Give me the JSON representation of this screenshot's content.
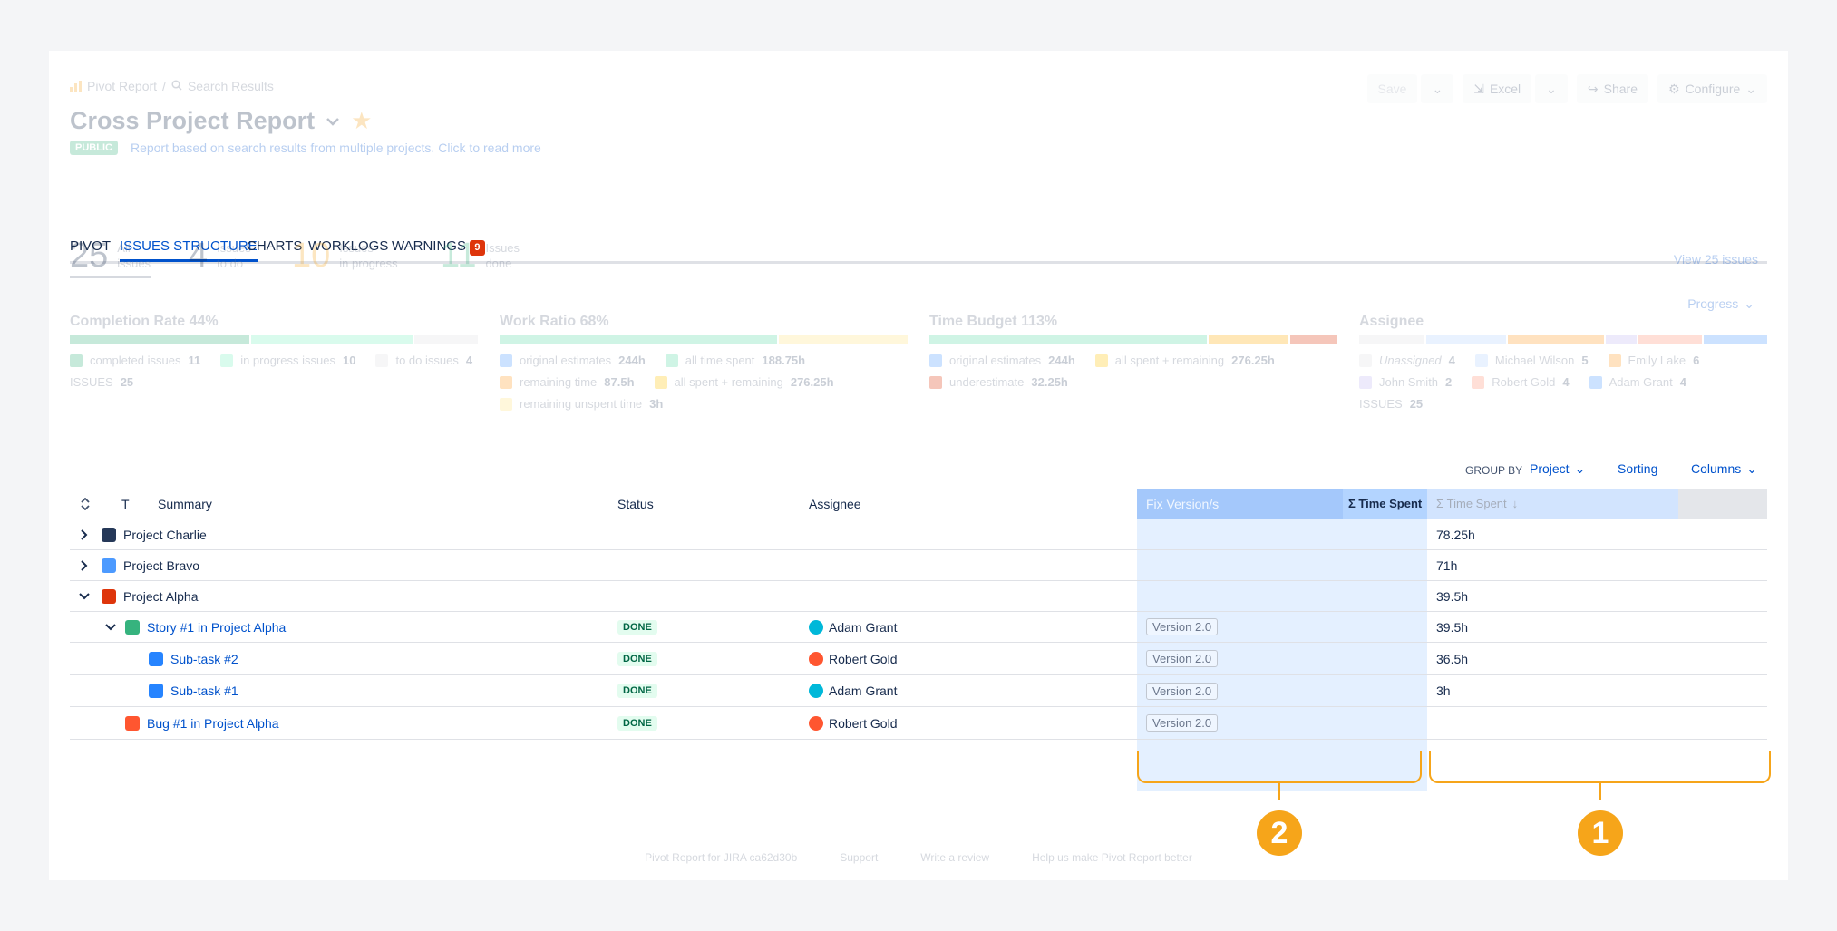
{
  "breadcrumb": {
    "root": "Pivot Report",
    "separator": "/",
    "current": "Search Results"
  },
  "header": {
    "title": "Cross Project Report",
    "badge": "PUBLIC",
    "description": "Report based on search results from multiple projects. Click to read more",
    "actions": {
      "save": "Save",
      "excel": "Excel",
      "share": "Share",
      "configure": "Configure"
    }
  },
  "tabs": [
    {
      "label": "PIVOT"
    },
    {
      "label": "ISSUES STRUCTURE"
    },
    {
      "label": "CHARTS"
    },
    {
      "label": "WORKLOGS"
    },
    {
      "label": "WARNINGS",
      "count": "9"
    }
  ],
  "stats": [
    {
      "value": "25",
      "line1": "All",
      "line2": "issues",
      "color": "#6b778c"
    },
    {
      "value": "4",
      "line1": "Issues",
      "line2": "to do",
      "color": "#6b778c"
    },
    {
      "value": "10",
      "line1": "Issues",
      "line2": "in progress",
      "color": "#f5a623"
    },
    {
      "value": "11",
      "line1": "Issues",
      "line2": "done",
      "color": "#36b37e"
    }
  ],
  "view_issues": "View 25 issues",
  "progress_label": "Progress",
  "metrics": {
    "completion": {
      "label": "Completion Rate",
      "value": "44%",
      "segments": [
        {
          "fraction": 0.44,
          "color": "#36b37e"
        },
        {
          "fraction": 0.4,
          "color": "#79f2c0"
        },
        {
          "fraction": 0.16,
          "color": "#dfe1e6"
        }
      ],
      "legend": [
        {
          "label": "completed issues",
          "value": "11",
          "color": "#36b37e"
        },
        {
          "label": "in progress issues",
          "value": "10",
          "color": "#79f2c0"
        },
        {
          "label": "to do issues",
          "value": "4",
          "color": "#dfe1e6"
        },
        {
          "label": "ISSUES",
          "value": "25",
          "color": ""
        }
      ]
    },
    "work_ratio": {
      "label": "Work Ratio",
      "value": "68%",
      "segments": [
        {
          "fraction": 0.68,
          "color": "#57d9a3"
        },
        {
          "fraction": 0.32,
          "color": "#ffe380"
        }
      ],
      "legend": [
        {
          "label": "original estimates",
          "value": "244h",
          "color": "#4c9aff"
        },
        {
          "label": "all time spent",
          "value": "188.75h",
          "color": "#57d9a3"
        },
        {
          "label": "remaining time",
          "value": "87.5h",
          "color": "#ff991f"
        },
        {
          "label": "all spent + remaining",
          "value": "276.25h",
          "color": "#ffc400"
        },
        {
          "label": "remaining unspent time",
          "value": "3h",
          "color": "#ffe380"
        }
      ]
    },
    "time_budget": {
      "label": "Time Budget",
      "value": "113%",
      "segments": [
        {
          "fraction": 0.68,
          "color": "#57d9a3"
        },
        {
          "fraction": 0.2,
          "color": "#ffab00"
        },
        {
          "fraction": 0.12,
          "color": "#de350b"
        }
      ],
      "legend": [
        {
          "label": "original estimates",
          "value": "244h",
          "color": "#4c9aff"
        },
        {
          "label": "all spent + remaining",
          "value": "276.25h",
          "color": "#ffc400"
        },
        {
          "label": "underestimate",
          "value": "32.25h",
          "color": "#de350b"
        }
      ]
    },
    "assignee": {
      "label": "Assignee",
      "segments": [
        {
          "fraction": 0.16,
          "color": "#dfe1e6"
        },
        {
          "fraction": 0.2,
          "color": "#b3d4ff"
        },
        {
          "fraction": 0.24,
          "color": "#ff991f"
        },
        {
          "fraction": 0.08,
          "color": "#c0b6f2"
        },
        {
          "fraction": 0.16,
          "color": "#ff8f73"
        },
        {
          "fraction": 0.16,
          "color": "#4c9aff"
        }
      ],
      "legend": [
        {
          "label": "Unassigned",
          "value": "4",
          "color": "#dfe1e6"
        },
        {
          "label": "Michael Wilson",
          "value": "5",
          "color": "#b3d4ff"
        },
        {
          "label": "Emily Lake",
          "value": "6",
          "color": "#ff991f"
        },
        {
          "label": "John Smith",
          "value": "2",
          "color": "#c0b6f2"
        },
        {
          "label": "Robert Gold",
          "value": "4",
          "color": "#ff8f73"
        },
        {
          "label": "Adam Grant",
          "value": "4",
          "color": "#4c9aff"
        },
        {
          "label": "ISSUES",
          "value": "25",
          "color": ""
        }
      ]
    }
  },
  "toolbar": {
    "group_by": "GROUP BY",
    "group_value": "Project",
    "sorting": "Sorting",
    "columns": "Columns"
  },
  "table": {
    "headers": {
      "type": "T",
      "summary": "Summary",
      "status": "Status",
      "assignee": "Assignee",
      "fix_version": "Fix Version/s",
      "sum_time_spent": "Σ Time Spent",
      "sum_time_spent_dim": "Σ Time Spent"
    },
    "rows": [
      {
        "summary": "Project Charlie",
        "status": "",
        "assignee": "",
        "version": "",
        "time": "78.25h"
      },
      {
        "summary": "Project Bravo",
        "status": "",
        "assignee": "",
        "version": "",
        "time": "71h"
      },
      {
        "summary": "Project Alpha",
        "status": "",
        "assignee": "",
        "version": "",
        "time": "39.5h"
      },
      {
        "summary": "Story #1 in Project Alpha",
        "status": "DONE",
        "assignee": "Adam Grant",
        "version": "Version 2.0",
        "time": "39.5h"
      },
      {
        "summary": "Sub-task #2",
        "status": "DONE",
        "assignee": "Robert Gold",
        "version": "Version 2.0",
        "time": "36.5h"
      },
      {
        "summary": "Sub-task #1",
        "status": "DONE",
        "assignee": "Adam Grant",
        "version": "Version 2.0",
        "time": "3h"
      },
      {
        "summary": "Bug #1 in Project Alpha",
        "status": "DONE",
        "assignee": "Robert Gold",
        "version": "Version 2.0",
        "time": ""
      }
    ]
  },
  "annotations": {
    "left": "2",
    "right": "1"
  },
  "footer": {
    "version": "Pivot Report for JIRA ca62d30b",
    "support": "Support",
    "review": "Write a review",
    "feedback": "Help us make Pivot Report better"
  }
}
